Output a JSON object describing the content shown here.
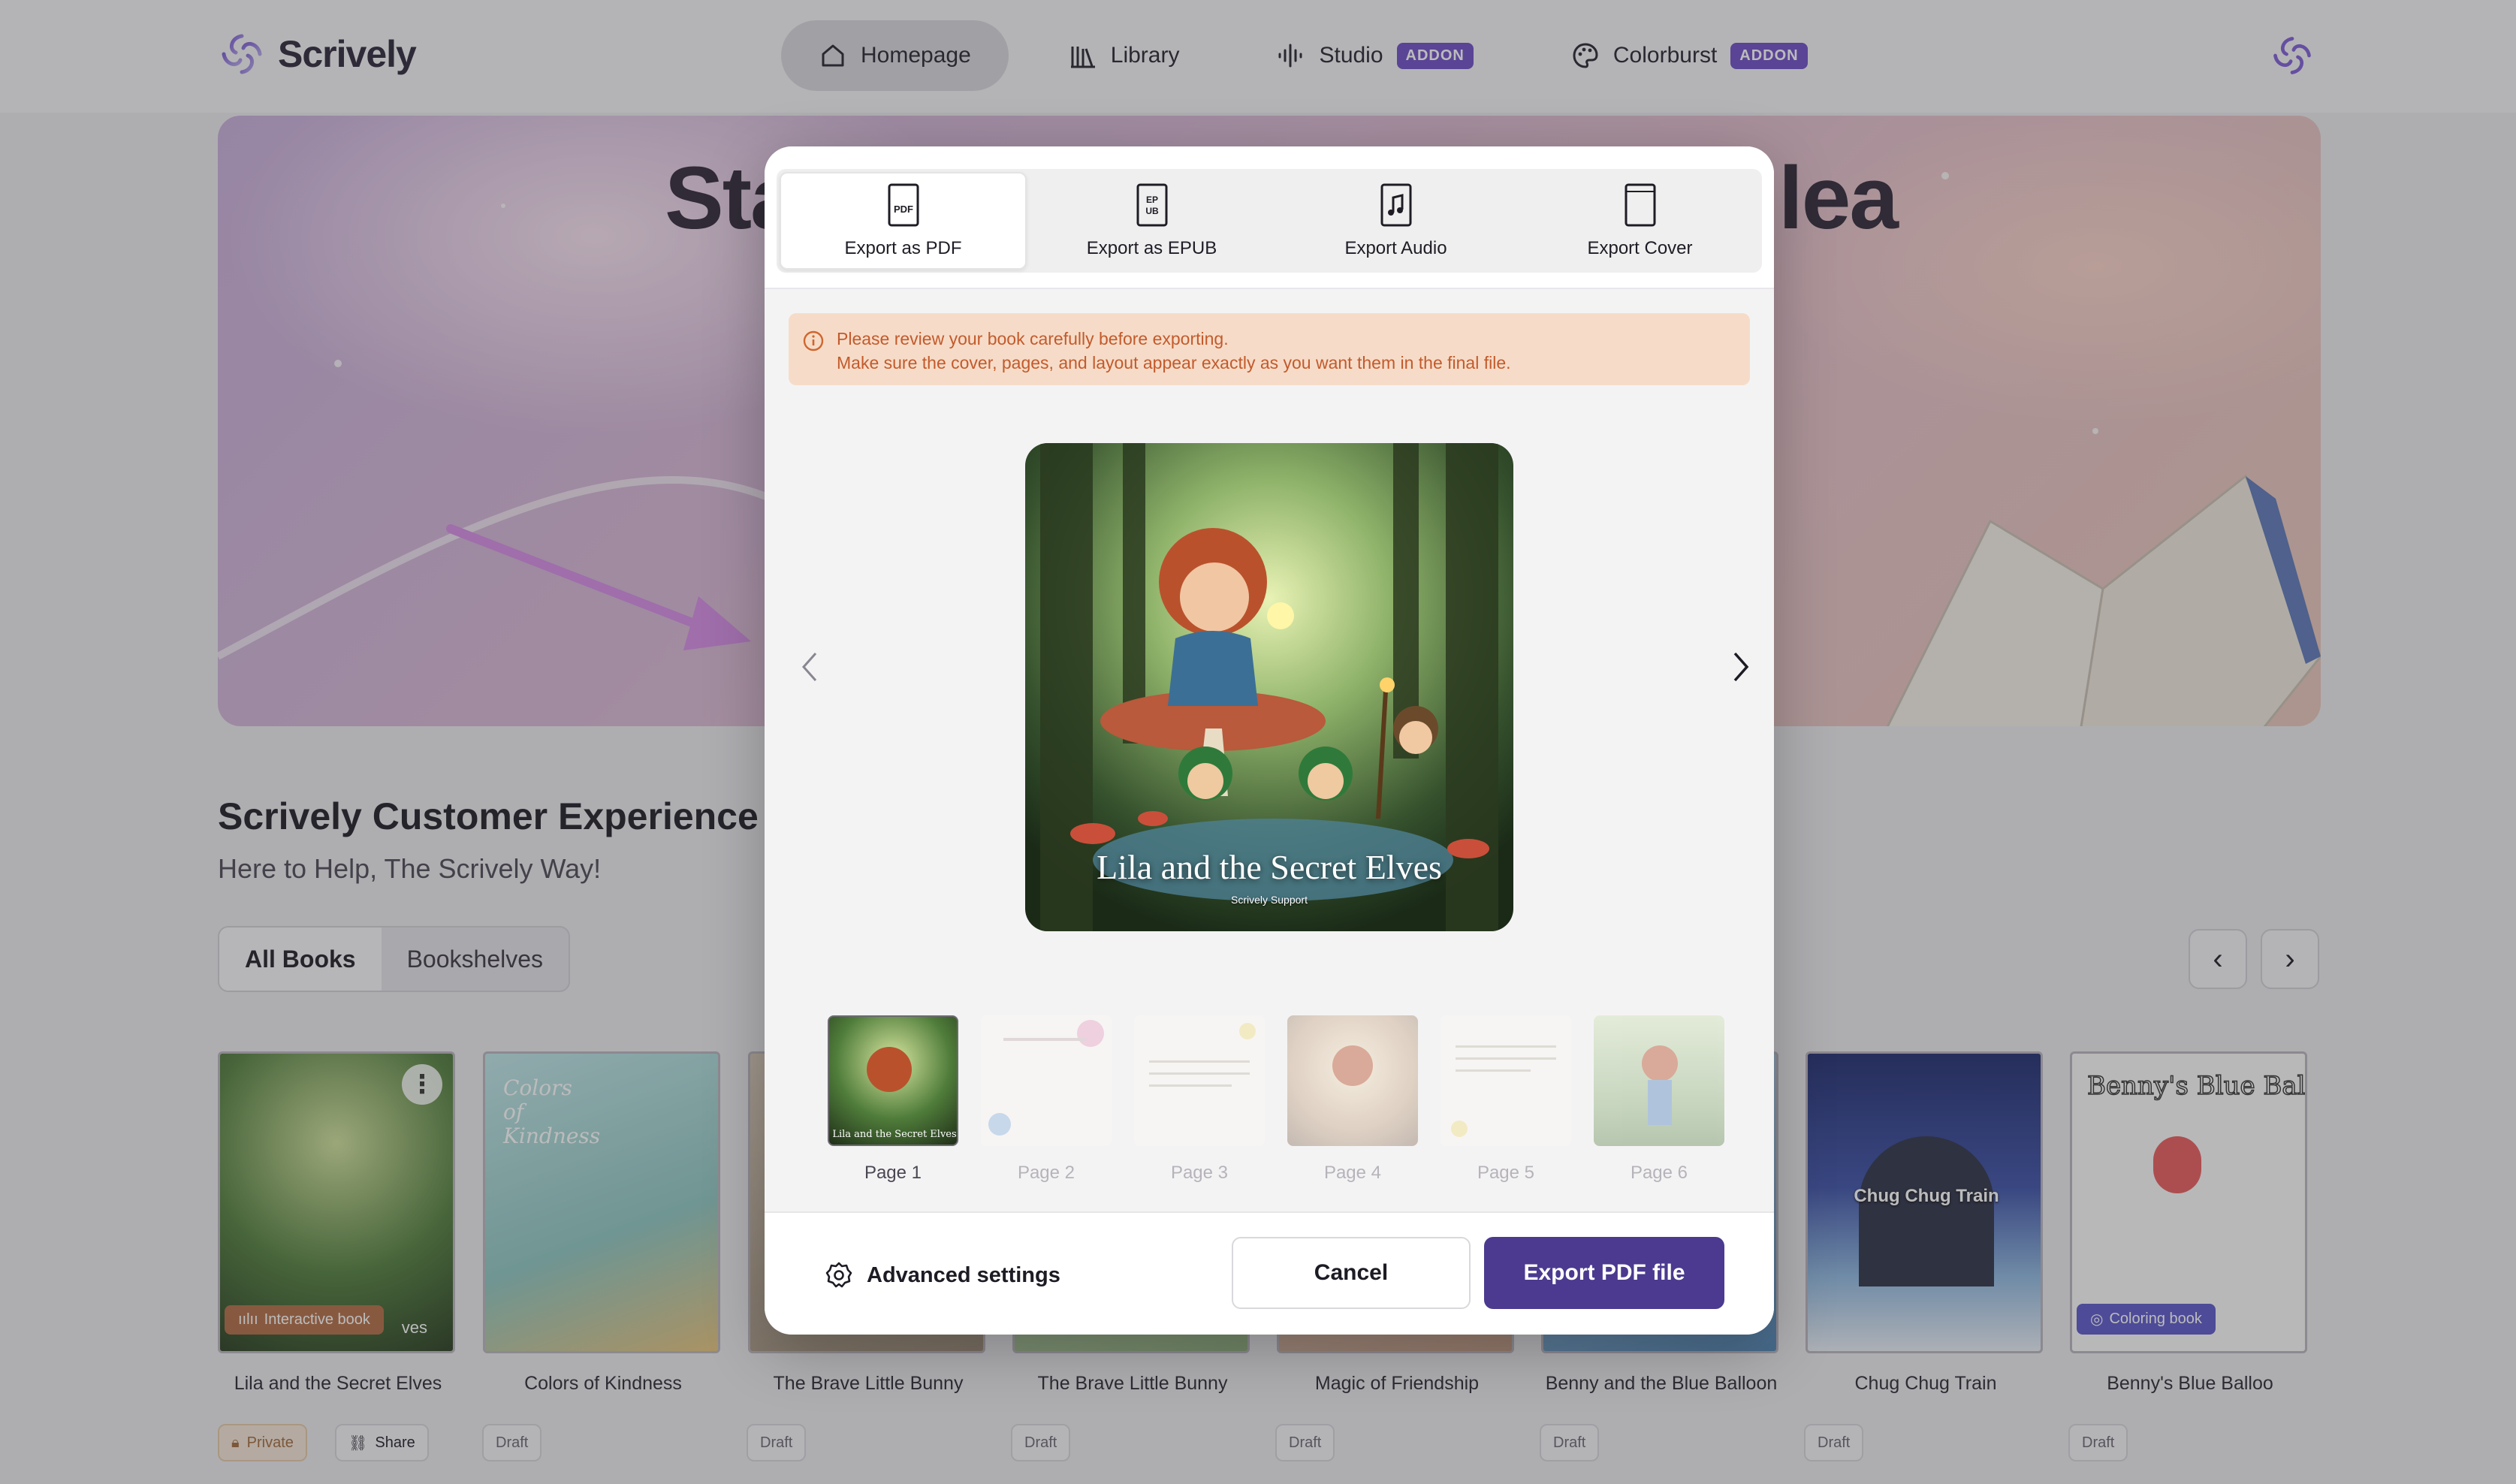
{
  "app": {
    "name": "Scrively",
    "accent": "#6c4bc4",
    "primary_button": "#4b3a8f"
  },
  "nav": {
    "items": [
      {
        "label": "Homepage",
        "icon": "home-icon",
        "active": true
      },
      {
        "label": "Library",
        "icon": "library-icon"
      },
      {
        "label": "Studio",
        "icon": "audio-wave-icon",
        "badge": "ADDON"
      },
      {
        "label": "Colorburst",
        "icon": "palette-icon",
        "badge": "ADDON"
      }
    ]
  },
  "hero": {
    "title_left": "Sta",
    "title_right": "lea"
  },
  "section": {
    "title": "Scrively Customer Experience Te",
    "subtitle": "Here to Help, The Scrively Way!"
  },
  "segments": {
    "all_books": "All Books",
    "bookshelves": "Bookshelves"
  },
  "carousel": {
    "prev": "‹",
    "next": "›"
  },
  "books": [
    {
      "title": "Lila and the Secret Elves",
      "badge": "Interactive book",
      "cover_text": "ves"
    },
    {
      "title": "Colors of Kindness",
      "status": "Draft",
      "cover_text": "Colors of Kindness"
    },
    {
      "title": "The Brave Little Bunny",
      "status": "Draft"
    },
    {
      "title": "The Brave Little Bunny",
      "status": "Draft"
    },
    {
      "title": "Magic of Friendship",
      "status": "Draft"
    },
    {
      "title": "Benny and the Blue Balloon",
      "status": "Draft"
    },
    {
      "title": "Chug Chug Train",
      "status": "Draft",
      "cover_text": "Chug Chug Train"
    },
    {
      "title": "Benny's Blue Balloo",
      "status": "Draft",
      "badge": "Coloring book",
      "cover_text": "Benny's Blue Balloon"
    }
  ],
  "book_actions": {
    "private": "Private",
    "share": "Share"
  },
  "modal": {
    "tabs": [
      {
        "label": "Export as PDF",
        "icon": "pdf-file-icon",
        "active": true
      },
      {
        "label": "Export as EPUB",
        "icon": "epub-file-icon"
      },
      {
        "label": "Export Audio",
        "icon": "audio-file-icon"
      },
      {
        "label": "Export Cover",
        "icon": "cover-page-icon"
      }
    ],
    "alert": {
      "line1": "Please review your book carefully before exporting.",
      "line2": "Make sure the cover, pages, and layout appear exactly as you want them in the final file."
    },
    "preview": {
      "title": "Lila and the Secret Elves",
      "author": "Scrively Support"
    },
    "pages": [
      "Page 1",
      "Page 2",
      "Page 3",
      "Page 4",
      "Page 5",
      "Page 6"
    ],
    "selected_page": "Page 1",
    "footer": {
      "advanced": "Advanced settings",
      "cancel": "Cancel",
      "export": "Export PDF file"
    }
  }
}
